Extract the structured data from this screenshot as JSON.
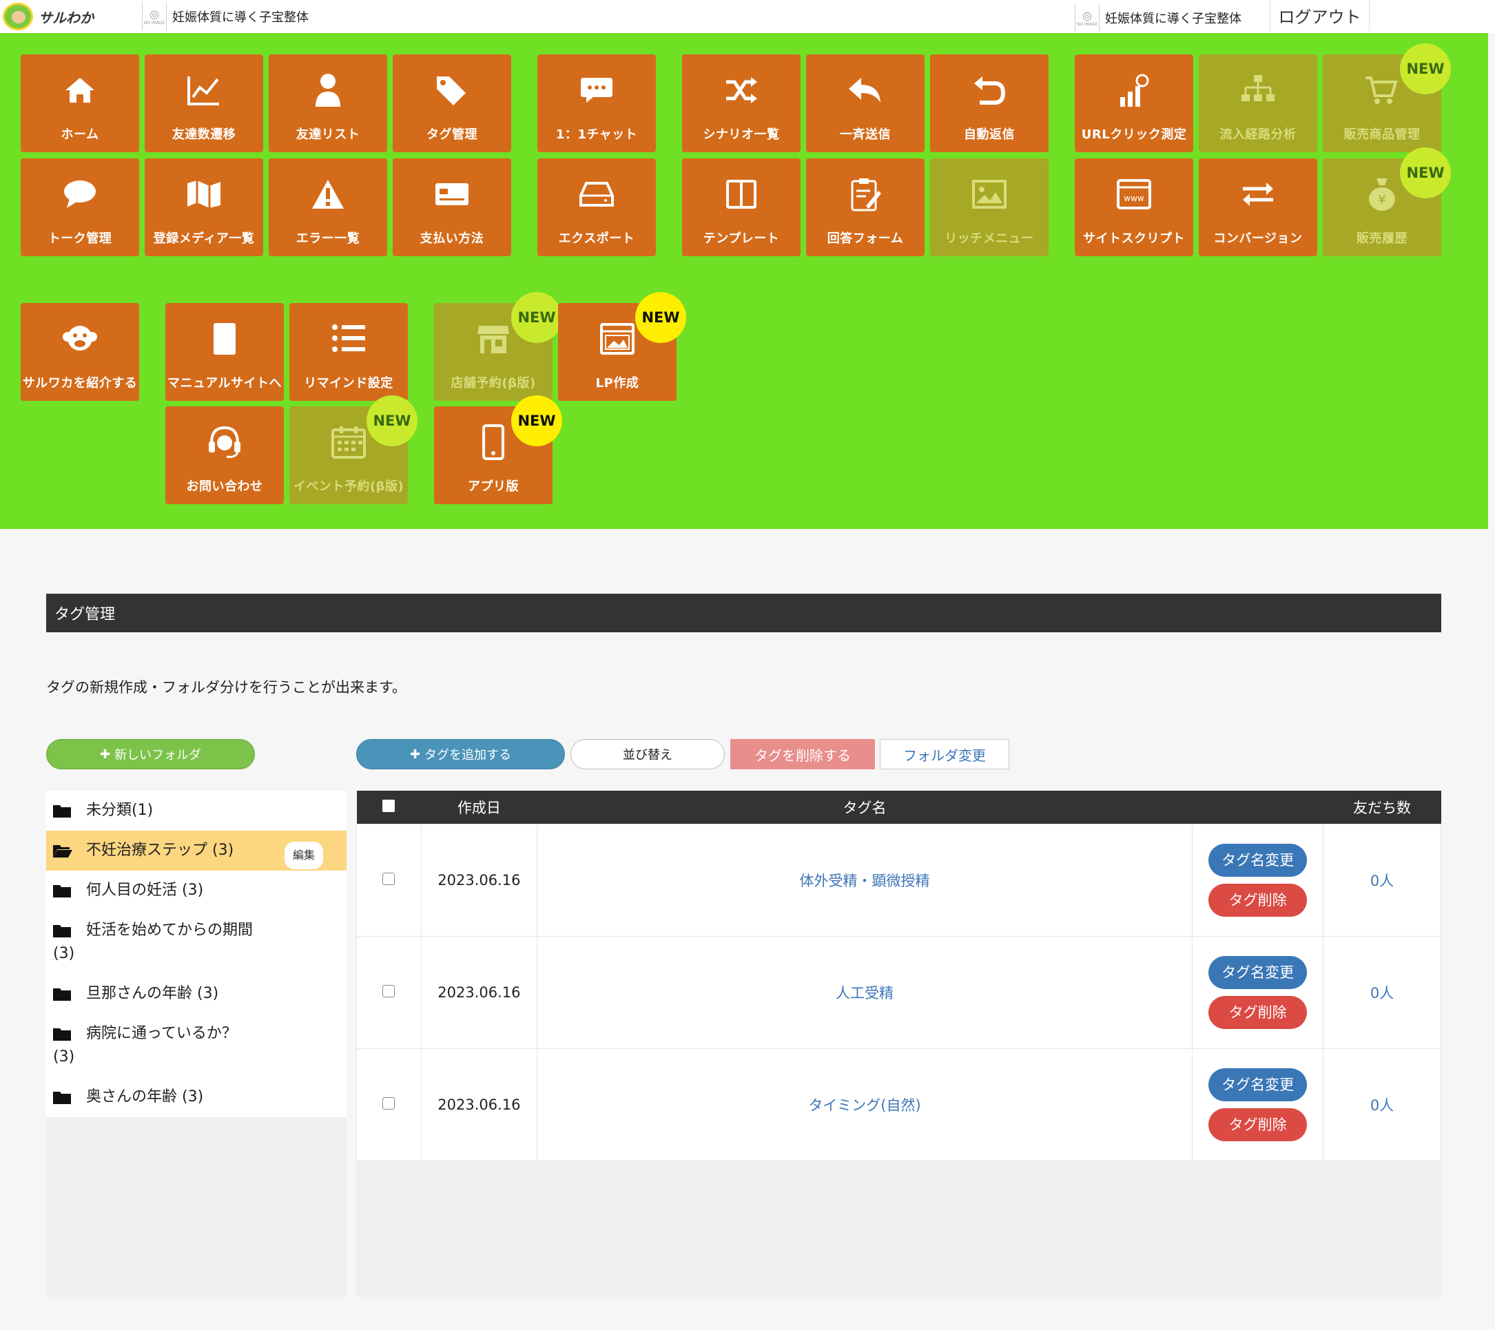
{
  "header": {
    "logo_text": "サルわか",
    "account_left": "妊娠体質に導く子宝整体",
    "account_right": "妊娠体質に導く子宝整体",
    "noimage_label": "NO IMAGE",
    "logout": "ログアウト"
  },
  "menu": {
    "new_badge": "NEW",
    "tiles": [
      {
        "label": "ホーム",
        "icon": "home-icon"
      },
      {
        "label": "友達数遷移",
        "icon": "line-chart-icon"
      },
      {
        "label": "友達リスト",
        "icon": "user-icon"
      },
      {
        "label": "タグ管理",
        "icon": "tags-icon"
      },
      {
        "label": "1：1チャット",
        "icon": "chat-bubble-icon"
      },
      {
        "label": "シナリオ一覧",
        "icon": "shuffle-icon"
      },
      {
        "label": "一斉送信",
        "icon": "reply-icon"
      },
      {
        "label": "自動返信",
        "icon": "return-icon"
      },
      {
        "label": "URLクリック測定",
        "icon": "analytics-icon"
      },
      {
        "label": "流入経路分析",
        "icon": "sitemap-icon"
      },
      {
        "label": "販売商品管理",
        "icon": "cart-icon"
      },
      {
        "label": "トーク管理",
        "icon": "comment-icon"
      },
      {
        "label": "登録メディア一覧",
        "icon": "map-icon"
      },
      {
        "label": "エラー一覧",
        "icon": "warning-icon"
      },
      {
        "label": "支払い方法",
        "icon": "credit-card-icon"
      },
      {
        "label": "エクスポート",
        "icon": "drive-icon"
      },
      {
        "label": "テンプレート",
        "icon": "columns-icon"
      },
      {
        "label": "回答フォーム",
        "icon": "clipboard-icon"
      },
      {
        "label": "リッチメニュー",
        "icon": "image-icon"
      },
      {
        "label": "サイトスクリプト",
        "icon": "www-icon"
      },
      {
        "label": "コンバージョン",
        "icon": "exchange-icon"
      },
      {
        "label": "販売履歴",
        "icon": "money-bag-icon"
      },
      {
        "label": "サルワカを紹介する",
        "icon": "monkey-icon"
      },
      {
        "label": "マニュアルサイトへ",
        "icon": "book-icon"
      },
      {
        "label": "リマインド設定",
        "icon": "list-icon"
      },
      {
        "label": "店舗予約(β版)",
        "icon": "store-icon"
      },
      {
        "label": "LP作成",
        "icon": "browser-image-icon"
      },
      {
        "label": "お問い合わせ",
        "icon": "headset-icon"
      },
      {
        "label": "イベント予約(β版)",
        "icon": "calendar-icon"
      },
      {
        "label": "アプリ版",
        "icon": "mobile-icon"
      }
    ]
  },
  "page": {
    "title": "タグ管理",
    "description": "タグの新規作成・フォルダ分けを行うことが出来ます。"
  },
  "toolbar": {
    "new_folder": "新しいフォルダ",
    "add_tag": "タグを追加する",
    "sort": "並び替え",
    "delete_tags": "タグを削除する",
    "change_folder": "フォルダ変更"
  },
  "folders": {
    "edit_label": "編集",
    "items": [
      {
        "name": "未分類(1)"
      },
      {
        "name": "不妊治療ステップ (3)"
      },
      {
        "name": "何人目の妊活 (3)"
      },
      {
        "name": "妊活を始めてからの期間",
        "name2": "(3)"
      },
      {
        "name": "旦那さんの年齢 (3)"
      },
      {
        "name": "病院に通っているか？",
        "name2": "(3)"
      },
      {
        "name": "奥さんの年齢 (3)"
      }
    ]
  },
  "table": {
    "headers": {
      "created": "作成日",
      "name": "タグ名",
      "friends": "友だち数"
    },
    "rename_label": "タグ名変更",
    "delete_label": "タグ削除",
    "rows": [
      {
        "date": "2023.06.16",
        "name": "体外受精・顕微授精",
        "friends": "0人"
      },
      {
        "date": "2023.06.16",
        "name": "人工受精",
        "friends": "0人"
      },
      {
        "date": "2023.06.16",
        "name": "タイミング(自然)",
        "friends": "0人"
      }
    ]
  },
  "colors": {
    "menu_bg": "#70e024",
    "tile": "#d46b1a",
    "tile_disabled": "#a8a827",
    "active_folder": "#fcd680"
  }
}
